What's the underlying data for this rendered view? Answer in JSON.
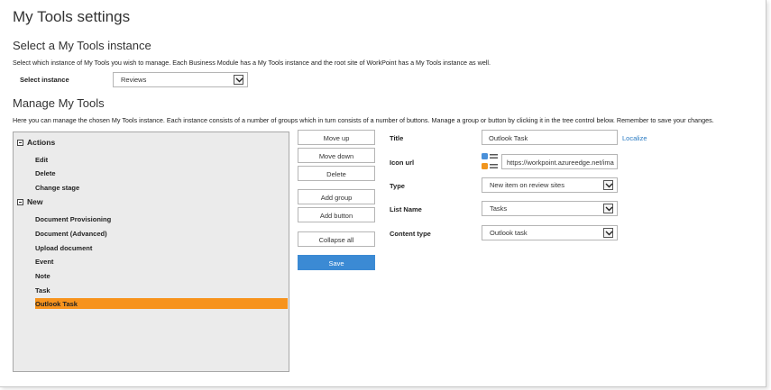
{
  "page": {
    "title": "My Tools settings"
  },
  "select_section": {
    "heading": "Select a My Tools instance",
    "description": "Select which instance of My Tools you wish to manage. Each Business Module has a My Tools instance and the root site of WorkPoint has a My Tools instance as well.",
    "label": "Select instance",
    "value": "Reviews"
  },
  "manage_section": {
    "heading": "Manage My Tools",
    "description": "Here you can manage the chosen My Tools instance. Each instance consists of a number of groups which in turn consists of a number of buttons. Manage a group or button by clicking it in the tree control below. Remember to save your changes."
  },
  "tree": {
    "groups": [
      {
        "label": "Actions",
        "items": [
          "Edit",
          "Delete",
          "Change stage"
        ]
      },
      {
        "label": "New",
        "items": [
          "Document Provisioning",
          "Document (Advanced)",
          "Upload document",
          "Event",
          "Note",
          "Task",
          "Outlook Task"
        ]
      }
    ],
    "selected": "Outlook Task"
  },
  "buttons": {
    "move_up": "Move up",
    "move_down": "Move down",
    "delete": "Delete",
    "add_group": "Add group",
    "add_button": "Add button",
    "collapse_all": "Collapse all",
    "save": "Save"
  },
  "form": {
    "title_label": "Title",
    "title_value": "Outlook Task",
    "localize_link": "Localize",
    "icon_label": "Icon url",
    "icon_value": "https://workpoint.azureedge.net/ima",
    "type_label": "Type",
    "type_value": "New item on review sites",
    "list_label": "List Name",
    "list_value": "Tasks",
    "content_type_label": "Content type",
    "content_type_value": "Outlook task"
  },
  "colors": {
    "selected": "#f7931d",
    "primary": "#3b8ad4",
    "link": "#2b7bc3",
    "icon_blue": "#4a90d9",
    "icon_orange": "#f0951e"
  }
}
